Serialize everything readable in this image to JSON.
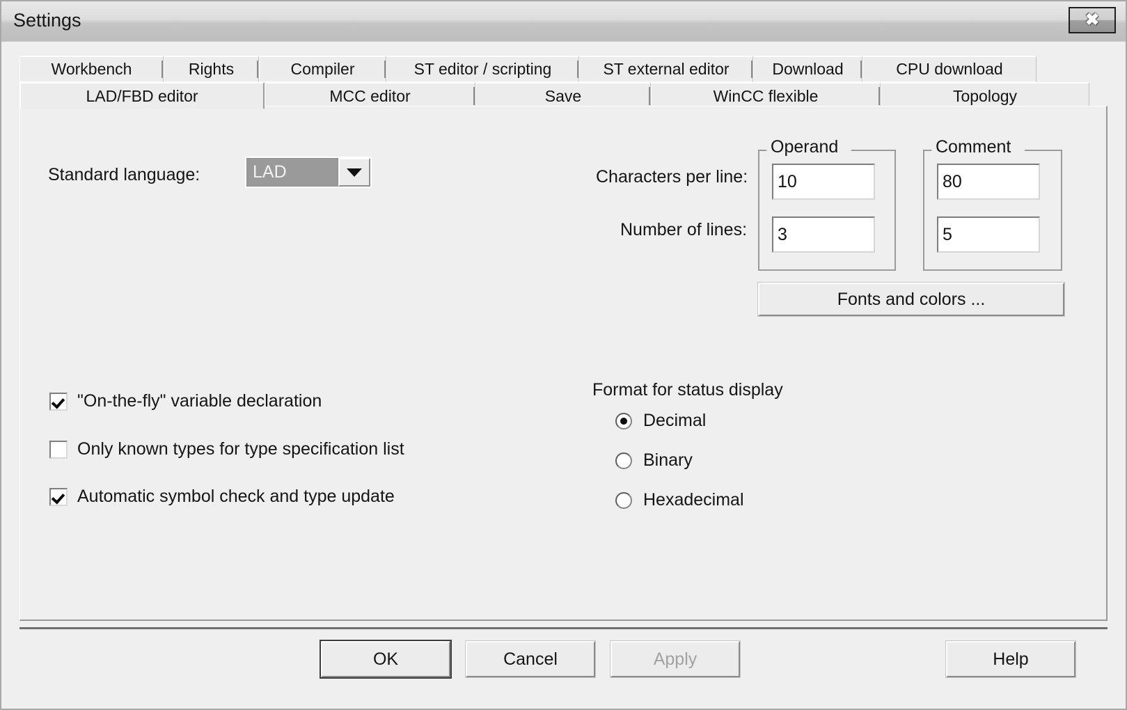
{
  "window": {
    "title": "Settings",
    "close_icon": "close-x-icon",
    "close_label": "✖"
  },
  "tabs": {
    "row1": [
      {
        "label": "Workbench",
        "active": false
      },
      {
        "label": "Rights",
        "active": false
      },
      {
        "label": "Compiler",
        "active": false
      },
      {
        "label": "ST editor / scripting",
        "active": false
      },
      {
        "label": "ST external editor",
        "active": false
      },
      {
        "label": "Download",
        "active": false
      },
      {
        "label": "CPU download",
        "active": false
      }
    ],
    "row2": [
      {
        "label": "LAD/FBD editor",
        "active": true
      },
      {
        "label": "MCC editor",
        "active": false
      },
      {
        "label": "Save",
        "active": false
      },
      {
        "label": "WinCC flexible",
        "active": false
      },
      {
        "label": "Topology",
        "active": false
      }
    ]
  },
  "form": {
    "standard_language_label": "Standard language:",
    "standard_language_value": "LAD",
    "dropdown_icon": "chevron-down-icon",
    "characters_per_line_label": "Characters per line:",
    "number_of_lines_label": "Number of lines:",
    "operand_group_title": "Operand",
    "comment_group_title": "Comment",
    "operand_characters_per_line": "10",
    "operand_number_of_lines": "3",
    "comment_characters_per_line": "80",
    "comment_number_of_lines": "5",
    "fonts_and_colors_label": "Fonts and colors ..."
  },
  "checkboxes": [
    {
      "label": "\"On-the-fly\" variable declaration",
      "checked": true
    },
    {
      "label": "Only known types for type specification list",
      "checked": false
    },
    {
      "label": "Automatic symbol check and type update",
      "checked": true
    }
  ],
  "status_display": {
    "group_label": "Format for status display",
    "options": [
      {
        "label": "Decimal",
        "selected": true
      },
      {
        "label": "Binary",
        "selected": false
      },
      {
        "label": "Hexadecimal",
        "selected": false
      }
    ]
  },
  "footer": {
    "ok_label": "OK",
    "cancel_label": "Cancel",
    "apply_label": "Apply",
    "apply_disabled": true,
    "help_label": "Help"
  },
  "colors": {
    "dialog_bg": "#efefef",
    "titlebar_top": "#e9e9e9",
    "titlebar_bottom": "#bdbdbd",
    "selection_bg": "#9a9a9a",
    "text": "#151515",
    "disabled_text": "#a2a2a2"
  }
}
